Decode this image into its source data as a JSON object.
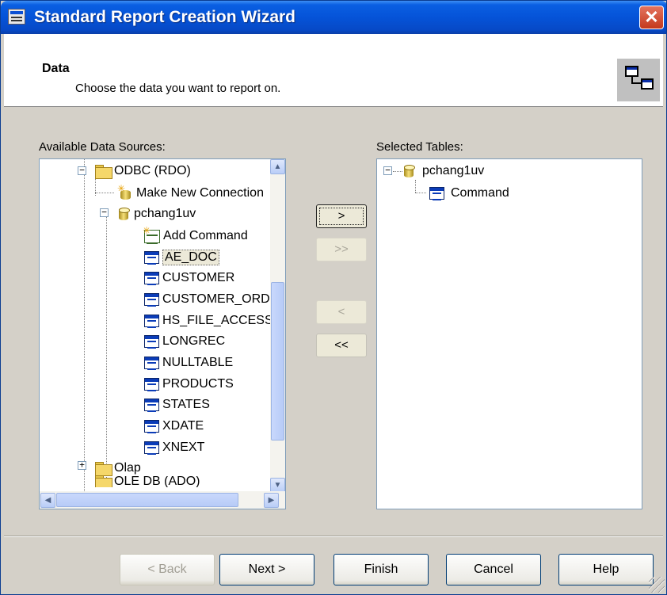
{
  "window": {
    "title": "Standard Report Creation Wizard",
    "close_label": "✕"
  },
  "header": {
    "title": "Data",
    "subtitle": "Choose the data you want to report on."
  },
  "available": {
    "label": "Available Data Sources:",
    "tree": [
      {
        "label": "ODBC (RDO)",
        "icon": "folder-icon"
      },
      {
        "label": "Make New Connection",
        "icon": "new-connection-icon"
      },
      {
        "label": "pchang1uv",
        "icon": "database-icon"
      },
      {
        "label": "Add Command",
        "icon": "add-command-icon"
      },
      {
        "label": "AE_DOC",
        "icon": "table-icon",
        "selected": true
      },
      {
        "label": "CUSTOMER",
        "icon": "table-icon"
      },
      {
        "label": "CUSTOMER_ORD",
        "icon": "table-icon"
      },
      {
        "label": "HS_FILE_ACCESS",
        "icon": "table-icon"
      },
      {
        "label": "LONGREC",
        "icon": "table-icon"
      },
      {
        "label": "NULLTABLE",
        "icon": "table-icon"
      },
      {
        "label": "PRODUCTS",
        "icon": "table-icon"
      },
      {
        "label": "STATES",
        "icon": "table-icon"
      },
      {
        "label": "XDATE",
        "icon": "table-icon"
      },
      {
        "label": "XNEXT",
        "icon": "table-icon"
      },
      {
        "label": "Olap",
        "icon": "folder-icon"
      },
      {
        "label": "OLE DB (ADO)",
        "icon": "folder-icon"
      }
    ]
  },
  "selected": {
    "label": "Selected Tables:",
    "tree": [
      {
        "label": "pchang1uv",
        "icon": "database-icon"
      },
      {
        "label": "Command",
        "icon": "table-icon"
      }
    ]
  },
  "move_buttons": {
    "add_one": ">",
    "add_all": ">>",
    "remove_one": "<",
    "remove_all": "<<"
  },
  "footer": {
    "back": "< Back",
    "next": "Next >",
    "finish": "Finish",
    "cancel": "Cancel",
    "help": "Help"
  },
  "colors": {
    "titlebar": "#0553d8",
    "dialog_bg": "#d4d0c8",
    "header_bg": "#ffffff"
  }
}
